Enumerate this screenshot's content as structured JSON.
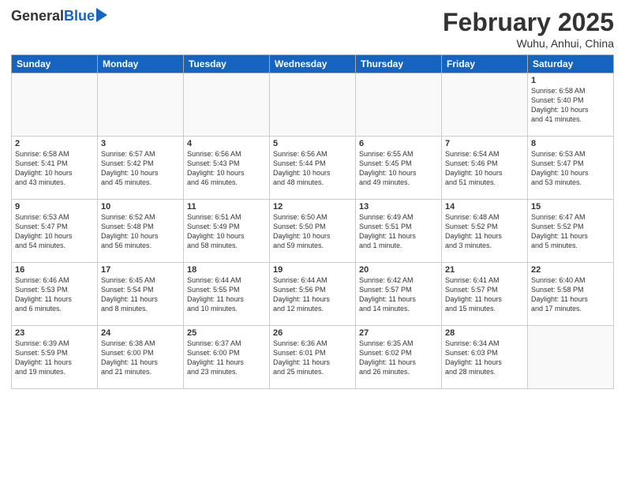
{
  "header": {
    "logo_general": "General",
    "logo_blue": "Blue",
    "month_title": "February 2025",
    "location": "Wuhu, Anhui, China"
  },
  "weekdays": [
    "Sunday",
    "Monday",
    "Tuesday",
    "Wednesday",
    "Thursday",
    "Friday",
    "Saturday"
  ],
  "weeks": [
    [
      {
        "day": "",
        "info": ""
      },
      {
        "day": "",
        "info": ""
      },
      {
        "day": "",
        "info": ""
      },
      {
        "day": "",
        "info": ""
      },
      {
        "day": "",
        "info": ""
      },
      {
        "day": "",
        "info": ""
      },
      {
        "day": "1",
        "info": "Sunrise: 6:58 AM\nSunset: 5:40 PM\nDaylight: 10 hours\nand 41 minutes."
      }
    ],
    [
      {
        "day": "2",
        "info": "Sunrise: 6:58 AM\nSunset: 5:41 PM\nDaylight: 10 hours\nand 43 minutes."
      },
      {
        "day": "3",
        "info": "Sunrise: 6:57 AM\nSunset: 5:42 PM\nDaylight: 10 hours\nand 45 minutes."
      },
      {
        "day": "4",
        "info": "Sunrise: 6:56 AM\nSunset: 5:43 PM\nDaylight: 10 hours\nand 46 minutes."
      },
      {
        "day": "5",
        "info": "Sunrise: 6:56 AM\nSunset: 5:44 PM\nDaylight: 10 hours\nand 48 minutes."
      },
      {
        "day": "6",
        "info": "Sunrise: 6:55 AM\nSunset: 5:45 PM\nDaylight: 10 hours\nand 49 minutes."
      },
      {
        "day": "7",
        "info": "Sunrise: 6:54 AM\nSunset: 5:46 PM\nDaylight: 10 hours\nand 51 minutes."
      },
      {
        "day": "8",
        "info": "Sunrise: 6:53 AM\nSunset: 5:47 PM\nDaylight: 10 hours\nand 53 minutes."
      }
    ],
    [
      {
        "day": "9",
        "info": "Sunrise: 6:53 AM\nSunset: 5:47 PM\nDaylight: 10 hours\nand 54 minutes."
      },
      {
        "day": "10",
        "info": "Sunrise: 6:52 AM\nSunset: 5:48 PM\nDaylight: 10 hours\nand 56 minutes."
      },
      {
        "day": "11",
        "info": "Sunrise: 6:51 AM\nSunset: 5:49 PM\nDaylight: 10 hours\nand 58 minutes."
      },
      {
        "day": "12",
        "info": "Sunrise: 6:50 AM\nSunset: 5:50 PM\nDaylight: 10 hours\nand 59 minutes."
      },
      {
        "day": "13",
        "info": "Sunrise: 6:49 AM\nSunset: 5:51 PM\nDaylight: 11 hours\nand 1 minute."
      },
      {
        "day": "14",
        "info": "Sunrise: 6:48 AM\nSunset: 5:52 PM\nDaylight: 11 hours\nand 3 minutes."
      },
      {
        "day": "15",
        "info": "Sunrise: 6:47 AM\nSunset: 5:52 PM\nDaylight: 11 hours\nand 5 minutes."
      }
    ],
    [
      {
        "day": "16",
        "info": "Sunrise: 6:46 AM\nSunset: 5:53 PM\nDaylight: 11 hours\nand 6 minutes."
      },
      {
        "day": "17",
        "info": "Sunrise: 6:45 AM\nSunset: 5:54 PM\nDaylight: 11 hours\nand 8 minutes."
      },
      {
        "day": "18",
        "info": "Sunrise: 6:44 AM\nSunset: 5:55 PM\nDaylight: 11 hours\nand 10 minutes."
      },
      {
        "day": "19",
        "info": "Sunrise: 6:44 AM\nSunset: 5:56 PM\nDaylight: 11 hours\nand 12 minutes."
      },
      {
        "day": "20",
        "info": "Sunrise: 6:42 AM\nSunset: 5:57 PM\nDaylight: 11 hours\nand 14 minutes."
      },
      {
        "day": "21",
        "info": "Sunrise: 6:41 AM\nSunset: 5:57 PM\nDaylight: 11 hours\nand 15 minutes."
      },
      {
        "day": "22",
        "info": "Sunrise: 6:40 AM\nSunset: 5:58 PM\nDaylight: 11 hours\nand 17 minutes."
      }
    ],
    [
      {
        "day": "23",
        "info": "Sunrise: 6:39 AM\nSunset: 5:59 PM\nDaylight: 11 hours\nand 19 minutes."
      },
      {
        "day": "24",
        "info": "Sunrise: 6:38 AM\nSunset: 6:00 PM\nDaylight: 11 hours\nand 21 minutes."
      },
      {
        "day": "25",
        "info": "Sunrise: 6:37 AM\nSunset: 6:00 PM\nDaylight: 11 hours\nand 23 minutes."
      },
      {
        "day": "26",
        "info": "Sunrise: 6:36 AM\nSunset: 6:01 PM\nDaylight: 11 hours\nand 25 minutes."
      },
      {
        "day": "27",
        "info": "Sunrise: 6:35 AM\nSunset: 6:02 PM\nDaylight: 11 hours\nand 26 minutes."
      },
      {
        "day": "28",
        "info": "Sunrise: 6:34 AM\nSunset: 6:03 PM\nDaylight: 11 hours\nand 28 minutes."
      },
      {
        "day": "",
        "info": ""
      }
    ]
  ]
}
